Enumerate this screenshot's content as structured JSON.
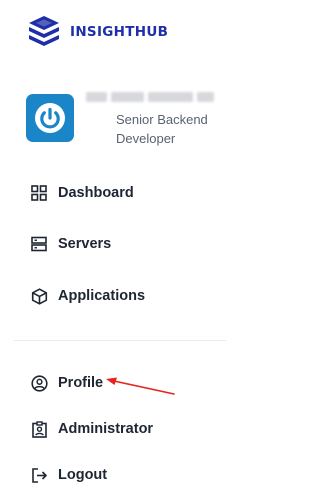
{
  "brand": {
    "name_part1": "INSIGHT",
    "name_part2": "HUB",
    "color": "#1e2fa8"
  },
  "user": {
    "name": "",
    "role": "Senior Backend Developer",
    "avatar_color": "#1a86c8",
    "avatar_icon": "power-icon"
  },
  "nav": {
    "primary": [
      {
        "label": "Dashboard",
        "icon": "grid-icon"
      },
      {
        "label": "Servers",
        "icon": "server-icon"
      },
      {
        "label": "Applications",
        "icon": "cube-icon"
      }
    ],
    "secondary": [
      {
        "label": "Profile",
        "icon": "user-circle-icon"
      },
      {
        "label": "Administrator",
        "icon": "id-badge-icon"
      },
      {
        "label": "Logout",
        "icon": "logout-icon"
      }
    ]
  },
  "annotation": {
    "type": "arrow",
    "color": "#e8231e",
    "points_to": "Profile"
  }
}
